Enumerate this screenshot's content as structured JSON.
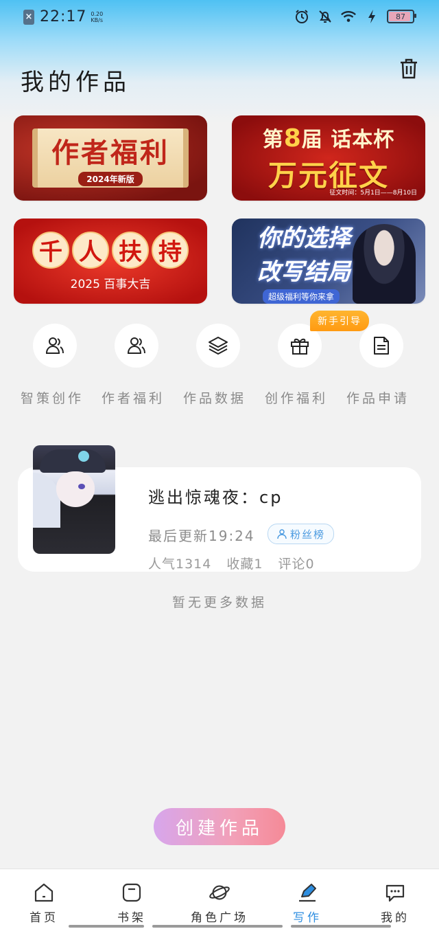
{
  "status_bar": {
    "time": "22:17",
    "net_speed_value": "0.20",
    "net_speed_unit": "KB/s",
    "battery": "87"
  },
  "header": {
    "title": "我的作品",
    "trash_icon": "trash-icon"
  },
  "banners": [
    {
      "title": "作者福利",
      "subtitle": "2024年新版"
    },
    {
      "line1_prefix": "第",
      "number": "8",
      "line1_mid": "届",
      "line1_suffix": "话本杯",
      "line2": "万元征文",
      "footer": "征文时间：5月1日——8月10日"
    },
    {
      "chars": [
        "千",
        "人",
        "扶",
        "持"
      ],
      "subtitle": "2025 百事大吉"
    },
    {
      "line1": "你的选择",
      "line2": "改写结局",
      "tag": "超级福利等你来拿"
    }
  ],
  "tools": [
    {
      "label": "智策创作",
      "icon": "person-icon"
    },
    {
      "label": "作者福利",
      "icon": "people-icon"
    },
    {
      "label": "作品数据",
      "icon": "layers-icon"
    },
    {
      "label": "创作福利",
      "icon": "gift-icon"
    },
    {
      "label": "作品申请",
      "icon": "document-icon"
    }
  ],
  "guide_badge": "新手引导",
  "work": {
    "title": "逃出惊魂夜：cp",
    "updated": "最后更新19:24",
    "fan_badge": "粉丝榜",
    "stats": [
      "人气1314",
      "收藏1",
      "评论0"
    ]
  },
  "no_more": "暂无更多数据",
  "create_button": "创建作品",
  "tabs": [
    {
      "label": "首页",
      "icon": "home-icon"
    },
    {
      "label": "书架",
      "icon": "bookshelf-icon"
    },
    {
      "label": "角色广场",
      "icon": "planet-icon"
    },
    {
      "label": "写作",
      "icon": "pen-icon",
      "active": true
    },
    {
      "label": "我的",
      "icon": "chat-bubble-icon"
    }
  ],
  "colors": {
    "accent_blue": "#2e8ee0",
    "guide_orange": "#ff9a12",
    "create_gradient_start": "#d7a6ec",
    "create_gradient_end": "#f58a97"
  }
}
